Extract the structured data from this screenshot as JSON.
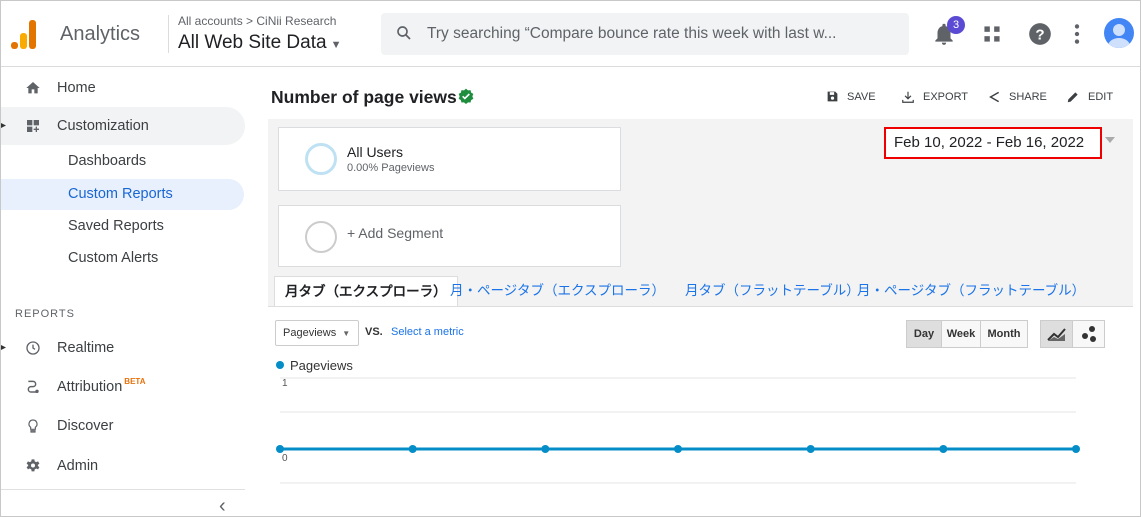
{
  "topbar": {
    "app_name": "Analytics",
    "account_path": "All accounts > CiNii Research",
    "view_name": "All Web Site Data",
    "search_placeholder": "Try searching “Compare bounce rate this week with last w...",
    "notification_count": "3",
    "icons": [
      "analytics-logo-icon",
      "search-icon",
      "notifications-icon",
      "apps-grid-icon",
      "help-icon",
      "more-vert-icon",
      "avatar"
    ]
  },
  "sidebar": {
    "home": "Home",
    "customization": "Customization",
    "sub_items": [
      "Dashboards",
      "Custom Reports",
      "Saved Reports",
      "Custom Alerts"
    ],
    "reports_heading": "REPORTS",
    "realtime": "Realtime",
    "attribution": "Attribution",
    "attribution_badge": "BETA",
    "discover": "Discover",
    "admin": "Admin",
    "collapse": "‹"
  },
  "report": {
    "title": "Number of page views",
    "actions": {
      "save": "SAVE",
      "export": "EXPORT",
      "share": "SHARE",
      "edit": "EDIT"
    },
    "segment": {
      "name": "All Users",
      "sub": "0.00% Pageviews"
    },
    "add_segment": "+ Add Segment",
    "date_range": "Feb 10, 2022 - Feb 16, 2022",
    "tabs": [
      "月タブ（エクスプローラ）",
      "月・ページタブ（エクスプローラ）",
      "月タブ（フラットテーブル）",
      "月・ページタブ（フラットテーブル）"
    ],
    "metric": "Pageviews",
    "vs": "VS.",
    "select_metric": "Select a metric",
    "granularity": [
      "Day",
      "Week",
      "Month"
    ],
    "legend": "Pageviews"
  },
  "colors": {
    "accent": "#1a73e8",
    "series": "#058dc7",
    "date_highlight": "#e00000",
    "verified": "#1e8e3e"
  },
  "chart_data": {
    "type": "line",
    "series": [
      {
        "name": "Pageviews",
        "values": [
          0,
          0,
          0,
          0,
          0,
          0,
          0
        ]
      }
    ],
    "x_count": 7,
    "ylim": [
      0,
      1
    ],
    "yticks": [
      "1",
      "0"
    ],
    "grid": true
  }
}
